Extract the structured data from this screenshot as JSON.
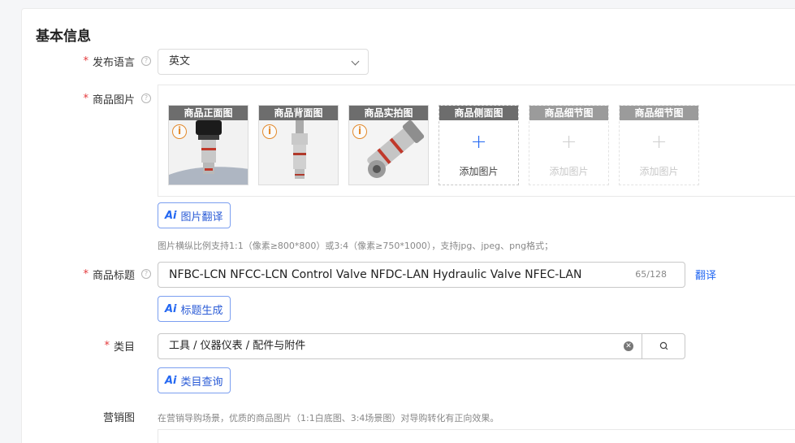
{
  "section_title": "基本信息",
  "language": {
    "label": "发布语言",
    "value": "英文"
  },
  "images": {
    "label": "商品图片",
    "slots": [
      {
        "caption": "商品正面图"
      },
      {
        "caption": "商品背面图"
      },
      {
        "caption": "商品实拍图"
      },
      {
        "caption": "商品侧面图",
        "add_label": "添加图片"
      },
      {
        "caption": "商品细节图",
        "add_label": "添加图片"
      },
      {
        "caption": "商品细节图",
        "add_label": "添加图片"
      }
    ],
    "ai_button": "图片翻译",
    "hint": "图片横纵比例支持1:1（像素≥800*800）或3:4（像素≥750*1000），支持jpg、jpeg、png格式；"
  },
  "title": {
    "label": "商品标题",
    "value": "NFBC-LCN NFCC-LCN Control Valve NFDC-LAN Hydraulic Valve NFEC-LAN",
    "count": "65/128",
    "translate_link": "翻译",
    "ai_button": "标题生成"
  },
  "category": {
    "label": "类目",
    "value": "工具 / 仪器仪表 / 配件与附件",
    "ai_button": "类目查询"
  },
  "marketing": {
    "label": "营销图",
    "hint": "在营销导购场景，优质的商品图片（1:1白底图、3:4场景图）对导购转化有正向效果。"
  },
  "ai_glyph": "Ai",
  "required_mark": "*",
  "help_glyph": "?",
  "info_glyph": "i",
  "colors": {
    "accent": "#2468f2",
    "required": "#e4393c",
    "warning": "#e38a2c",
    "caption_bg": "#6d6d6d"
  }
}
